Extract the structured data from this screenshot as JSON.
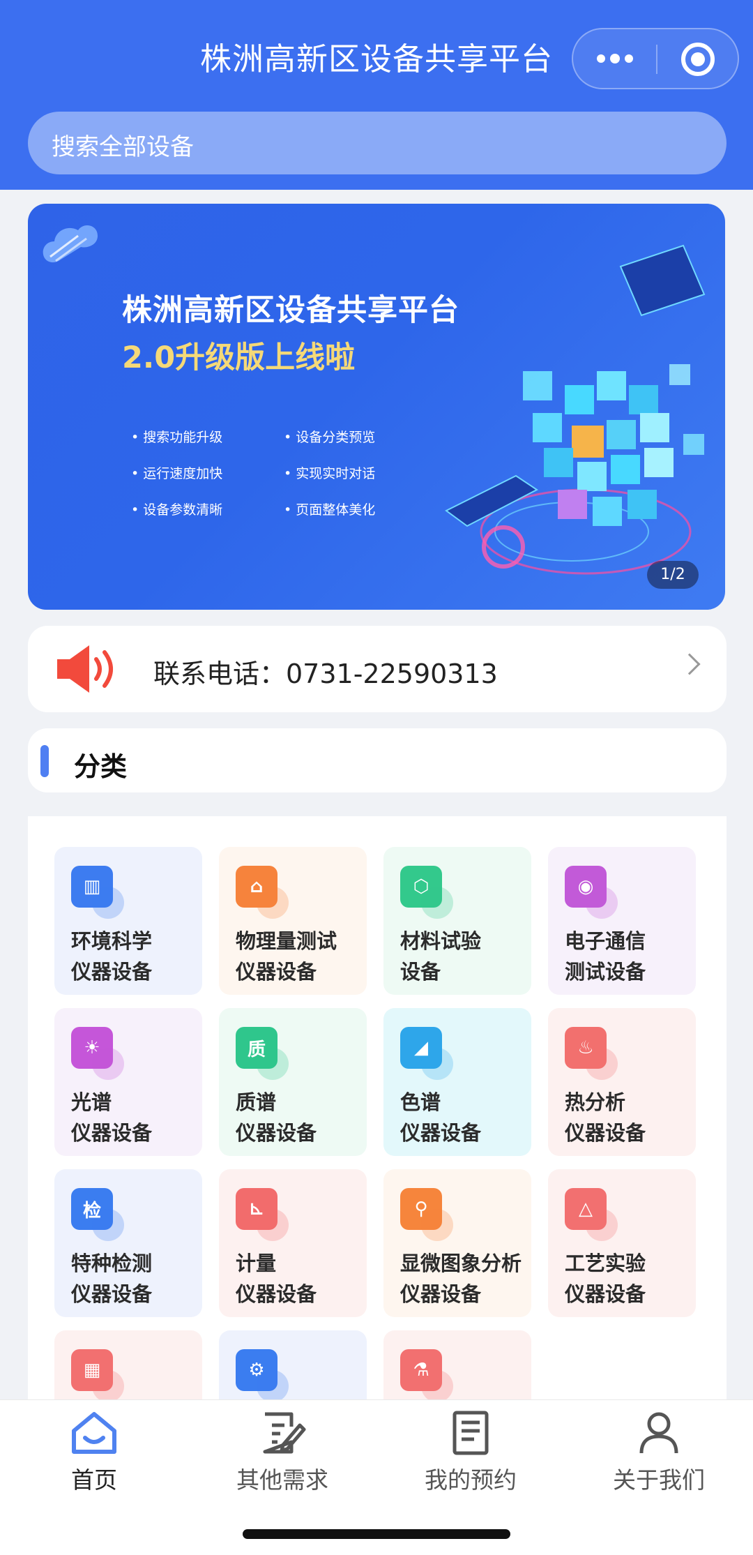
{
  "nav": {
    "title": "株洲高新区设备共享平台"
  },
  "search": {
    "placeholder": "搜索全部设备"
  },
  "banner": {
    "title": "株洲高新区设备共享平台",
    "subtitle": "2.0升级版上线啦",
    "features": [
      "搜索功能升级",
      "设备分类预览",
      "运行速度加快",
      "实现实时对话",
      "设备参数清晰",
      "页面整体美化"
    ],
    "counter": "1/2"
  },
  "contact": {
    "text": "联系电话：0731-22590313"
  },
  "section": {
    "title": "分类"
  },
  "categories": [
    {
      "line1": "环境科学",
      "line2": "仪器设备",
      "icon": "leaf-chart-icon",
      "color": "#3d7cf0",
      "bg": "#eef2fd"
    },
    {
      "line1": "物理量测试",
      "line2": "仪器设备",
      "icon": "instrument-icon",
      "color": "#f6833c",
      "bg": "#fef6ef"
    },
    {
      "line1": "材料试验",
      "line2": "设备",
      "icon": "molecule-icon",
      "color": "#33c98c",
      "bg": "#eefaf4"
    },
    {
      "line1": "电子通信",
      "line2": "测试设备",
      "icon": "antenna-icon",
      "color": "#c25ad8",
      "bg": "#f7f1fb"
    },
    {
      "line1": "光谱",
      "line2": "仪器设备",
      "icon": "spectrum-icon",
      "color": "#c556d9",
      "bg": "#f7f1fb"
    },
    {
      "line1": "质谱",
      "line2": "仪器设备",
      "icon": "quality-badge-icon",
      "color": "#2fc68c",
      "bg": "#eefaf4"
    },
    {
      "line1": "色谱",
      "line2": "仪器设备",
      "icon": "area-chart-icon",
      "color": "#2ea6ea",
      "bg": "#e3f8fb"
    },
    {
      "line1": "热分析",
      "line2": "仪器设备",
      "icon": "thermometer-icon",
      "color": "#f2706e",
      "bg": "#fdf1f0"
    },
    {
      "line1": "特种检测",
      "line2": "仪器设备",
      "icon": "inspection-icon",
      "color": "#3b7df0",
      "bg": "#eef2fd"
    },
    {
      "line1": "计量",
      "line2": "仪器设备",
      "icon": "ruler-icon",
      "color": "#f26c6c",
      "bg": "#fdf1f0"
    },
    {
      "line1": "显微图象分析",
      "line2": "仪器设备",
      "icon": "microscope-icon",
      "color": "#f6853c",
      "bg": "#fef6ef"
    },
    {
      "line1": "工艺实验",
      "line2": "仪器设备",
      "icon": "triangle-frame-icon",
      "color": "#f27070",
      "bg": "#fdf1f0"
    },
    {
      "line1": "",
      "line2": "",
      "icon": "machine-icon",
      "color": "#f27070",
      "bg": "#fdf1f0"
    },
    {
      "line1": "",
      "line2": "",
      "icon": "factory-icon",
      "color": "#3b7df0",
      "bg": "#eef2fd"
    },
    {
      "line1": "",
      "line2": "",
      "icon": "flask-icon",
      "color": "#f27070",
      "bg": "#fdf1f0"
    }
  ],
  "tabs": [
    {
      "label": "首页",
      "icon": "home-icon",
      "active": true
    },
    {
      "label": "其他需求",
      "icon": "edit-icon",
      "active": false
    },
    {
      "label": "我的预约",
      "icon": "document-icon",
      "active": false
    },
    {
      "label": "关于我们",
      "icon": "person-icon",
      "active": false
    }
  ],
  "colors": {
    "primary": "#3c6ff0",
    "accent": "#4f7ff2",
    "banner_highlight": "#f5d978",
    "speaker": "#f24a3c"
  }
}
